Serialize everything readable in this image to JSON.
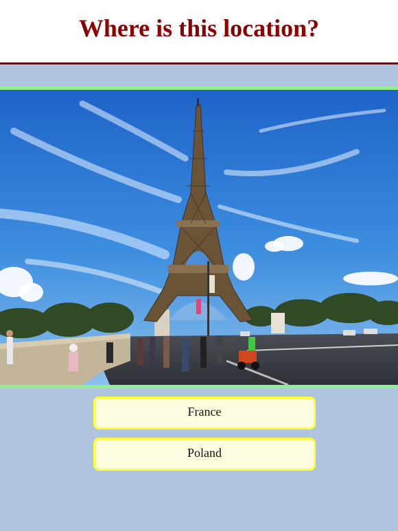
{
  "header": {
    "title": "Where is this location?"
  },
  "photo": {
    "subject": "eiffel-tower-photo"
  },
  "answers": [
    {
      "label": "France"
    },
    {
      "label": "Poland"
    }
  ],
  "colors": {
    "background": "#b0c4de",
    "title": "#8b0000",
    "header_rule": "#8b0000",
    "photo_border": "#90ee90",
    "answer_fill": "#fffde0",
    "answer_border": "#ffff33"
  }
}
